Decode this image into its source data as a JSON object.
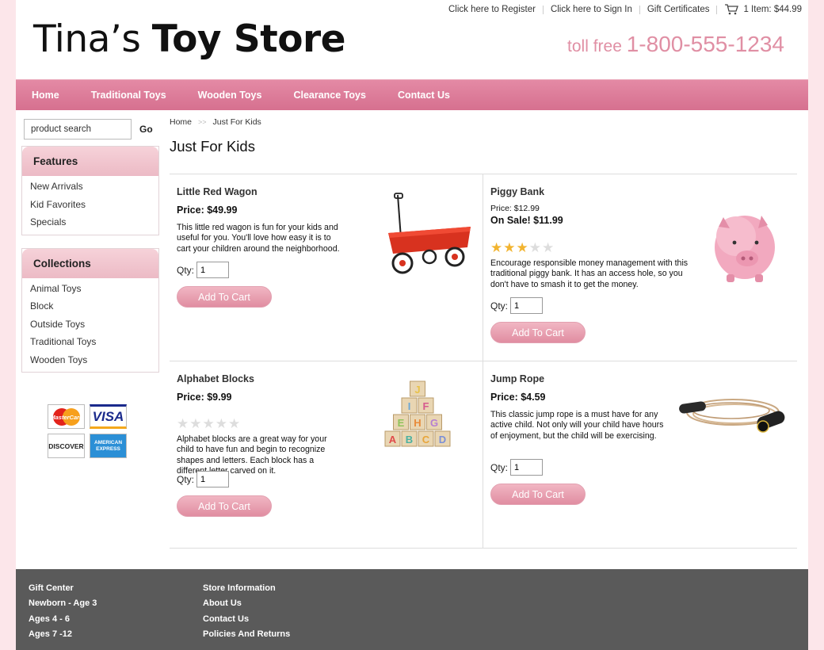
{
  "header": {
    "links": {
      "register": "Click here to Register",
      "sign_in": "Click here to Sign In",
      "gift_certificates": "Gift Certificates",
      "cart_summary": "1 Item: $44.99"
    },
    "logo_light": "Tina’s ",
    "logo_bold": "Toy Store",
    "phone_label": "toll free ",
    "phone_number": "1-800-555-1234"
  },
  "nav": {
    "items": [
      "Home",
      "Traditional Toys",
      "Wooden Toys",
      "Clearance Toys",
      "Contact Us"
    ]
  },
  "sidebar": {
    "search_placeholder": "product search",
    "go_label": "Go",
    "features": {
      "title": "Features",
      "items": [
        "New Arrivals",
        "Kid Favorites",
        "Specials"
      ]
    },
    "collections": {
      "title": "Collections",
      "items": [
        "Animal Toys",
        "Block",
        "Outside Toys",
        "Traditional Toys",
        "Wooden Toys"
      ]
    },
    "payment_cards": [
      "MasterCard",
      "VISA",
      "DISCOVER",
      "AMERICAN EXPRESS"
    ]
  },
  "breadcrumb": {
    "home": "Home",
    "current": "Just For Kids"
  },
  "page_title": "Just For Kids",
  "qty_label": "Qty:",
  "add_to_cart_label": "Add To Cart",
  "products": [
    {
      "name": "Little Red Wagon",
      "price": "Price: $49.99",
      "description": "This little red wagon is fun for your kids and useful for you. You'll love how easy it is to cart your children around the neighborhood.",
      "qty": "1"
    },
    {
      "name": "Piggy Bank",
      "price": "Price: $12.99",
      "sale_price": "On Sale! $11.99",
      "rating": 3,
      "rating_max": 5,
      "description": "Encourage responsible money management with this traditional piggy bank. It has an access hole, so you don't have to smash it to get the money.",
      "qty": "1"
    },
    {
      "name": "Alphabet Blocks",
      "price": "Price: $9.99",
      "rating": 0,
      "rating_max": 5,
      "description": "Alphabet blocks are a great way for your child to have fun and begin to recognize shapes and letters. Each block has a different letter carved on it.",
      "qty": "1",
      "block_letters": [
        "J",
        "I",
        "F",
        "E",
        "H",
        "G",
        "A",
        "B",
        "C",
        "D"
      ]
    },
    {
      "name": "Jump Rope",
      "price": "Price: $4.59",
      "description": "This classic jump rope is a must have for any active child. Not only will your child have hours of enjoyment, but the child will be exercising.",
      "qty": "1"
    }
  ],
  "footer": {
    "col1": [
      "Gift Center",
      "Newborn - Age 3",
      "Ages 4 - 6",
      "Ages 7 -12"
    ],
    "col2": [
      "Store Information",
      "About Us",
      "Contact Us",
      "Policies And Returns"
    ]
  },
  "colors": {
    "accent_pink": "#d6708f",
    "phone_pink": "#e08fa4",
    "footer_gray": "#5a5a5a",
    "star_gold": "#f2b430"
  }
}
